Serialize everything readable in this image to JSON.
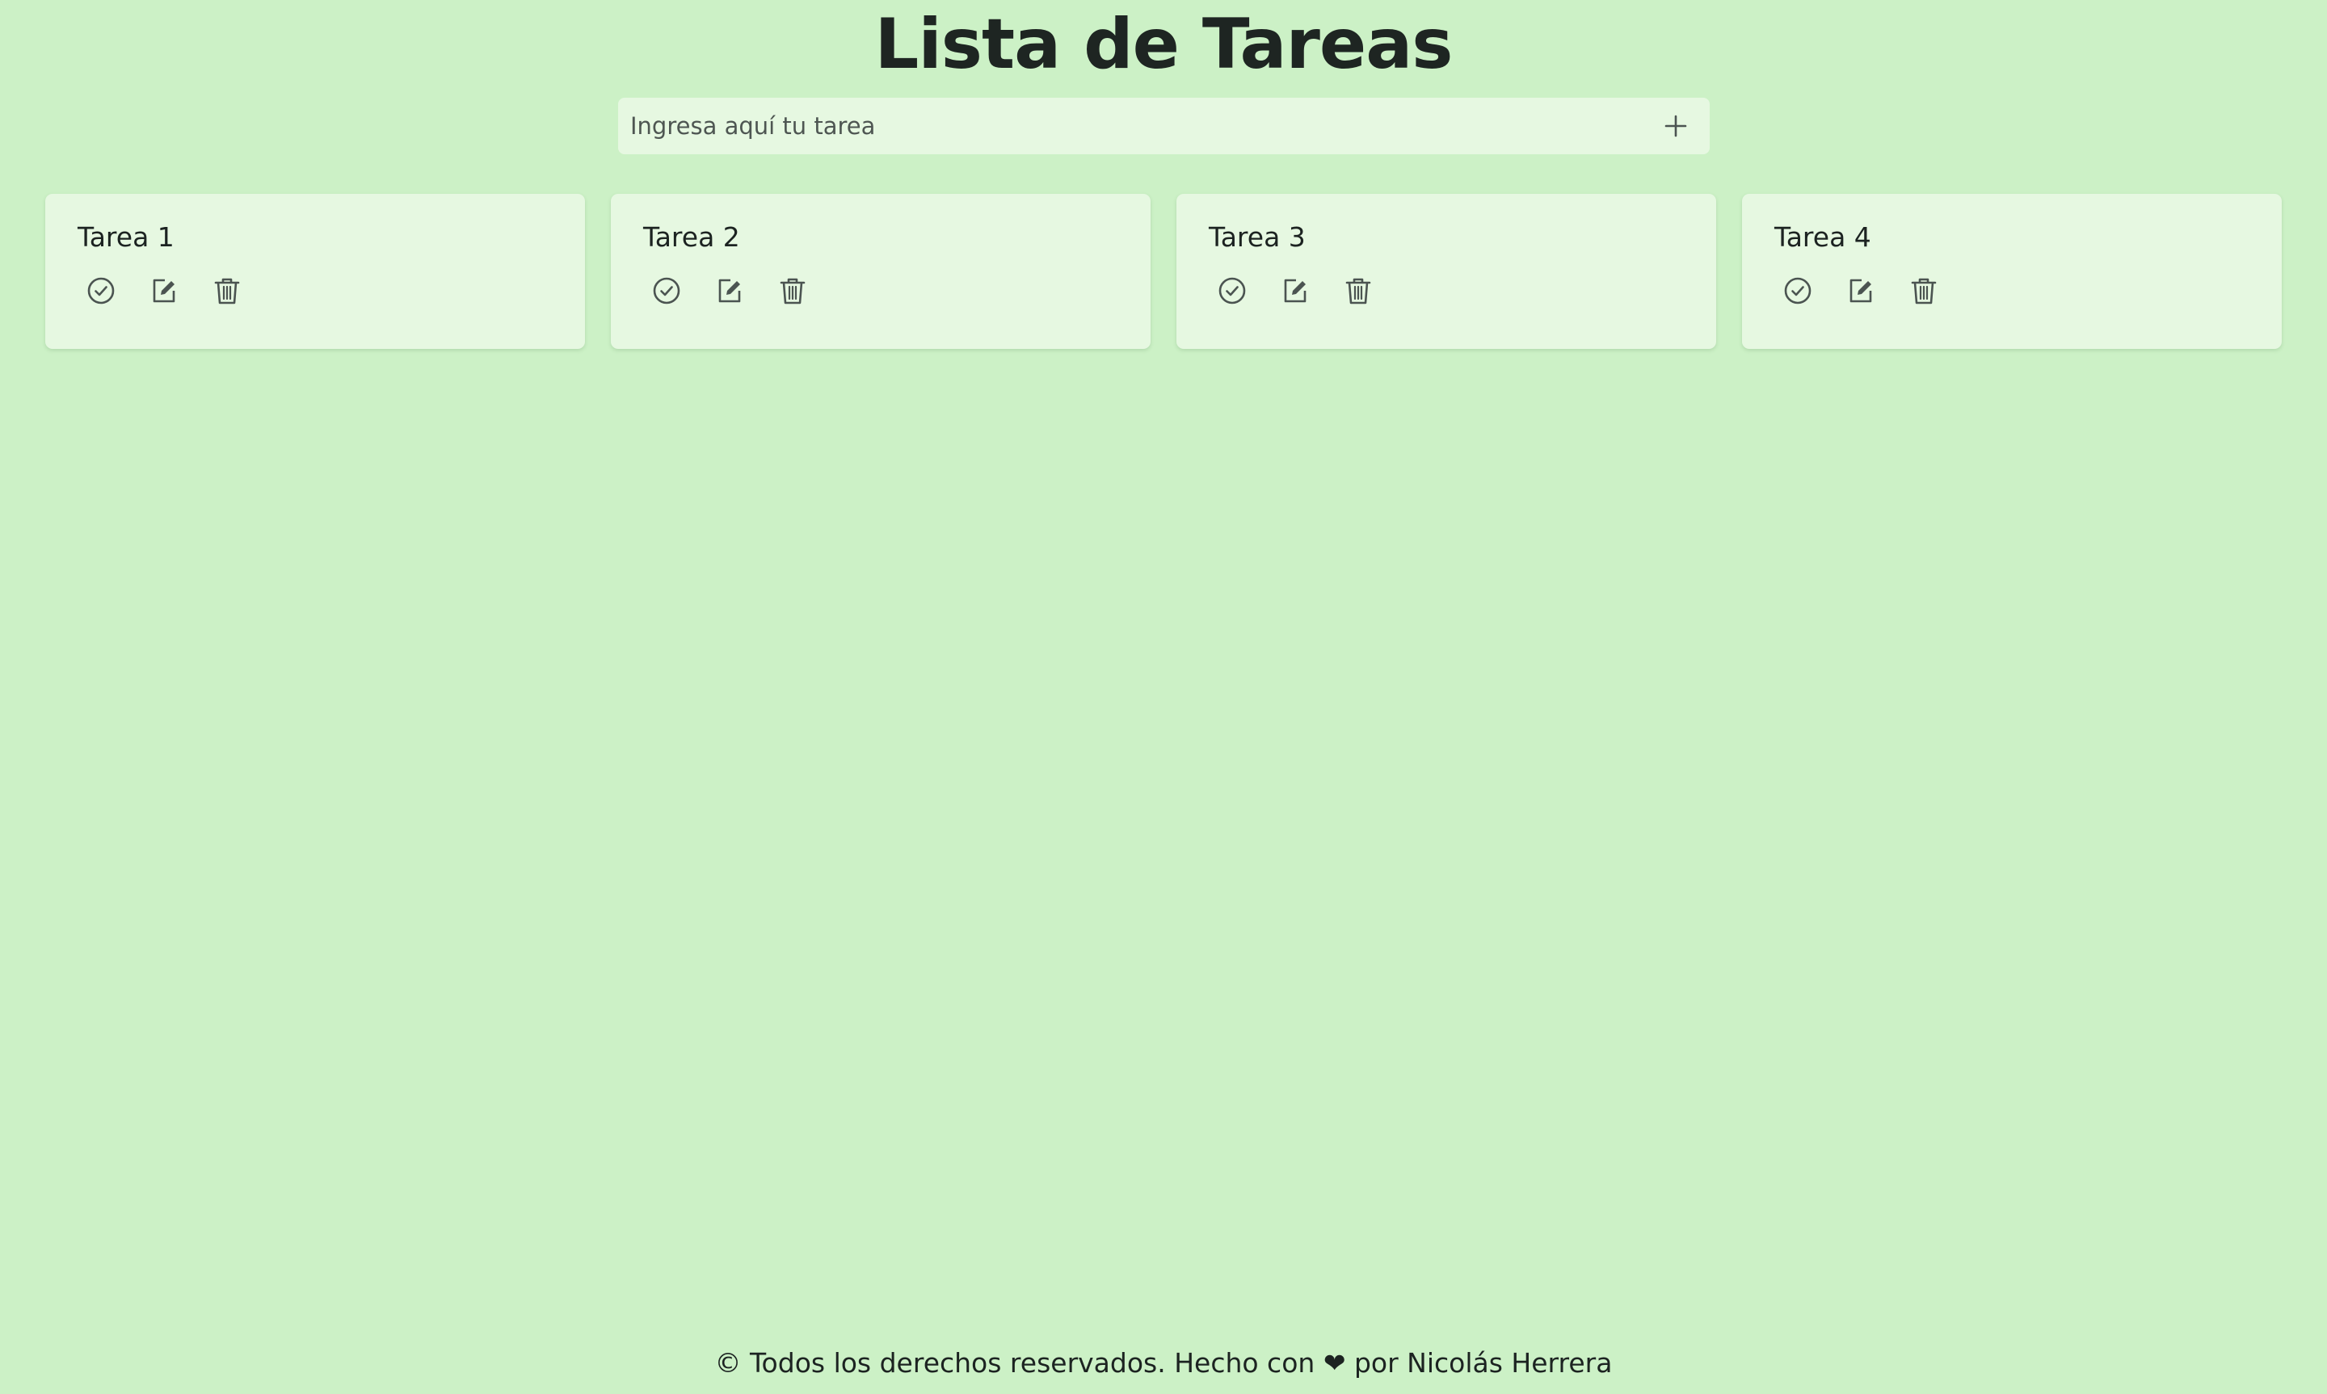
{
  "page": {
    "title": "Lista de Tareas"
  },
  "input": {
    "placeholder": "Ingresa aquí tu tarea",
    "value": "",
    "add_icon": "plus-icon"
  },
  "tasks": [
    {
      "title": "Tarea 1"
    },
    {
      "title": "Tarea 2"
    },
    {
      "title": "Tarea 3"
    },
    {
      "title": "Tarea 4"
    }
  ],
  "task_actions": [
    "check-circle-icon",
    "edit-icon",
    "trash-icon"
  ],
  "footer": {
    "text_before": "© Todos los derechos reservados. Hecho con",
    "heart": "❤",
    "text_after": "por Nicolás Herrera"
  },
  "colors": {
    "background": "#ccf1c6",
    "card": "#e6f8e1",
    "text": "#1c2321",
    "icon": "#4b5451"
  }
}
